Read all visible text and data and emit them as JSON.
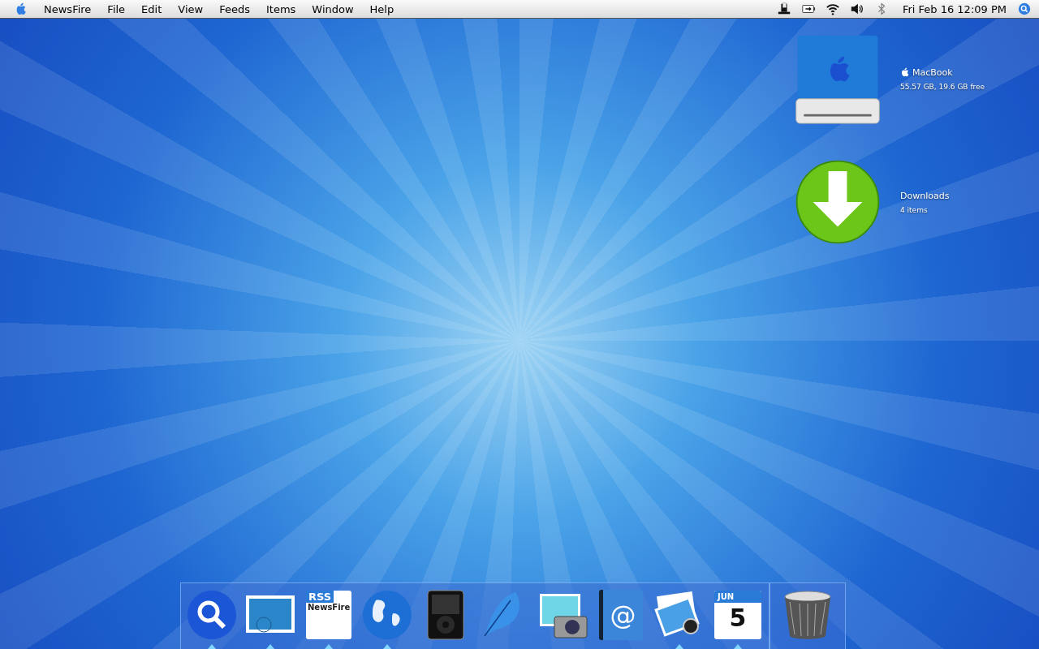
{
  "menu_bar": {
    "app_name": "NewsFire",
    "menus": [
      "File",
      "Edit",
      "View",
      "Feeds",
      "Items",
      "Window",
      "Help"
    ],
    "status_items": [
      {
        "kind": "hat"
      },
      {
        "kind": "battery"
      },
      {
        "kind": "wifi"
      },
      {
        "kind": "volume"
      },
      {
        "kind": "bluetooth"
      }
    ],
    "clock": "Fri Feb 16 12:09 PM"
  },
  "desktop_icons": [
    {
      "kind": "drive",
      "name": "MacBook",
      "info": "55.57 GB, 19.6 GB free"
    },
    {
      "kind": "downloads",
      "name": "Downloads",
      "info": "4 items"
    }
  ],
  "dock": {
    "items": [
      {
        "kind": "search",
        "running": true
      },
      {
        "kind": "stamp",
        "running": true
      },
      {
        "kind": "rss",
        "running": true,
        "texts": [
          "RSS",
          "NewsFire"
        ]
      },
      {
        "kind": "globe",
        "running": true
      },
      {
        "kind": "player",
        "running": false
      },
      {
        "kind": "feather",
        "running": false
      },
      {
        "kind": "photo",
        "running": false
      },
      {
        "kind": "book",
        "running": false,
        "texts": [
          "@"
        ]
      },
      {
        "kind": "preview",
        "running": true
      },
      {
        "kind": "calendar",
        "running": true,
        "texts": [
          "JUN",
          "5"
        ]
      }
    ],
    "trash": {
      "running": false
    }
  }
}
